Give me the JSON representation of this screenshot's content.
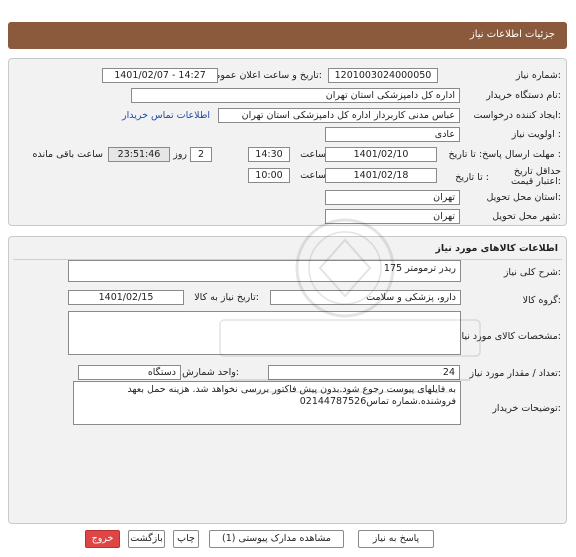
{
  "window": {
    "title": "جزئیات اطلاعات نیاز"
  },
  "need_info": {
    "need_number_label": "شماره نیاز:",
    "need_number": "1201003024000050",
    "announce_label": "تاریخ و ساعت اعلان عمومی:",
    "announce_value": "1401/02/07 - 14:27",
    "buyer_org_label": "نام دستگاه خریدار:",
    "buyer_org": "اداره کل دامپزشکی استان تهران",
    "requester_label": "ایجاد کننده درخواست:",
    "requester": "عباس  مدنی کاربرداز اداره کل دامپزشکی استان تهران",
    "contact_link": "اطلاعات تماس خریدار",
    "priority_label": "اولویت نیاز :",
    "priority": "عادی",
    "deadline_label": "مهلت ارسال پاسخ: تا تاریخ :",
    "deadline_date": "1401/02/10",
    "time_word": "ساعت",
    "deadline_time": "14:30",
    "days_value": "2",
    "days_word": "روز و",
    "remaining_time": "23:51:46",
    "remaining_label": "ساعت باقی مانده",
    "validity_label": "حداقل تاریخ اعتبار قیمت:",
    "validity_prefix": "تا تاریخ :",
    "validity_date": "1401/02/18",
    "validity_time": "10:00",
    "province_label": "استان محل تحویل:",
    "province": "تهران",
    "city_label": "شهر محل تحویل:",
    "city": "تهران"
  },
  "goods": {
    "section_title": "اطلاعات کالاهای مورد نیاز",
    "general_desc_label": "شرح کلی نیاز:",
    "general_desc": "ریدر ترمومتر 175",
    "group_label": "گروه کالا:",
    "group_value": "دارو، پزشکی و سلامت",
    "need_date_label": "تاریخ نیاز به کالا:",
    "need_date": "1401/02/15",
    "specs_label": "مشخصات کالای مورد نیاز:",
    "specs": "",
    "qty_label": "تعداد / مقدار مورد نیاز:",
    "qty": "24",
    "unit_label": "واحد شمارش:",
    "unit": "دستگاه",
    "buyer_notes_label": "توضیحات خریدار:",
    "buyer_notes": "به فایلهای پیوست رجوع شود.بدون پیش فاکتور بررسی نخواهد شد. هزینه حمل بعهد فروشنده.شماره تماس02144787526"
  },
  "actions": {
    "reply": "پاسخ به نیاز",
    "attachments": "مشاهده مدارک پیوستی (1)",
    "print": "چاپ",
    "back": "بازگشت",
    "exit": "خروج"
  },
  "colors": {
    "titlebar": "#8b5a3c",
    "exit_button": "#e04545",
    "link": "#1f4aa8"
  }
}
